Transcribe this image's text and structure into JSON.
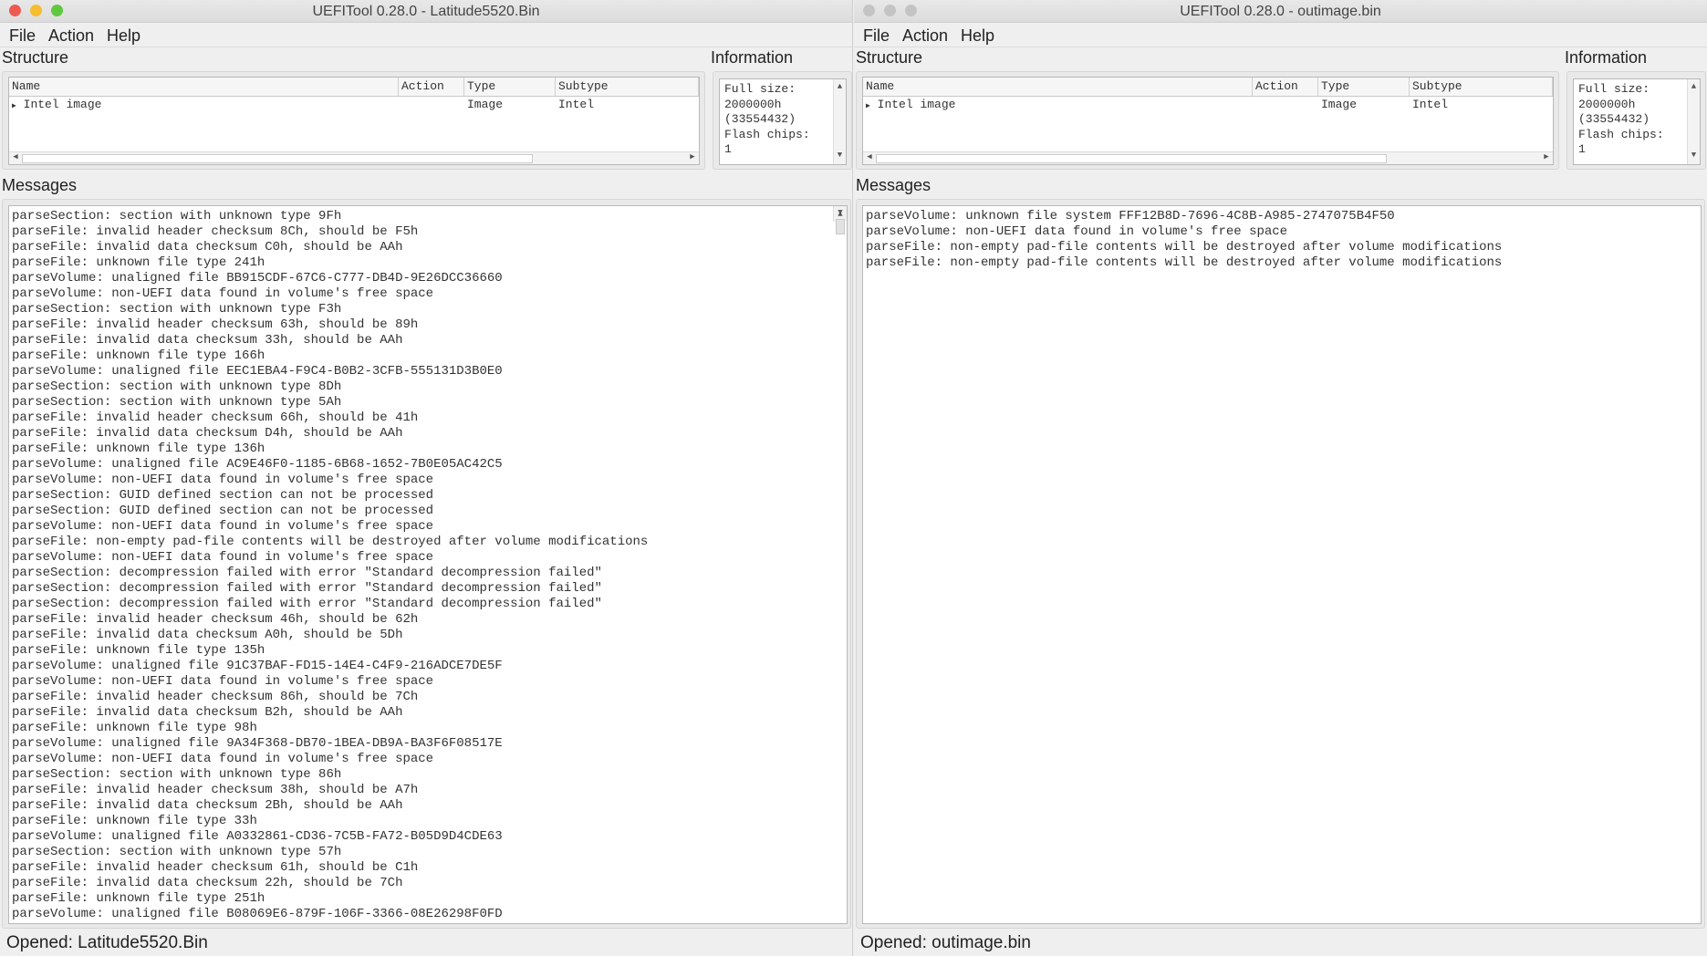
{
  "windows": [
    {
      "title": "UEFITool 0.28.0 - Latitude5520.Bin",
      "active": true,
      "menu": [
        "File",
        "Action",
        "Help"
      ],
      "structure_label": "Structure",
      "information_label": "Information",
      "messages_label": "Messages",
      "columns": [
        "Name",
        "Action",
        "Type",
        "Subtype"
      ],
      "rows": [
        {
          "name": "Intel image",
          "action": "",
          "type": "Image",
          "subtype": "Intel"
        }
      ],
      "info_lines": [
        "Full size:",
        "2000000h",
        "(33554432)",
        "Flash chips:",
        "1"
      ],
      "messages": [
        "parseSection: section with unknown type 9Fh",
        "parseFile: invalid header checksum 8Ch, should be F5h",
        "parseFile: invalid data checksum C0h, should be AAh",
        "parseFile: unknown file type 241h",
        "parseVolume: unaligned file BB915CDF-67C6-C777-DB4D-9E26DCC36660",
        "parseVolume: non-UEFI data found in volume's free space",
        "parseSection: section with unknown type F3h",
        "parseFile: invalid header checksum 63h, should be 89h",
        "parseFile: invalid data checksum 33h, should be AAh",
        "parseFile: unknown file type 166h",
        "parseVolume: unaligned file EEC1EBA4-F9C4-B0B2-3CFB-555131D3B0E0",
        "parseSection: section with unknown type 8Dh",
        "parseSection: section with unknown type 5Ah",
        "parseFile: invalid header checksum 66h, should be 41h",
        "parseFile: invalid data checksum D4h, should be AAh",
        "parseFile: unknown file type 136h",
        "parseVolume: unaligned file AC9E46F0-1185-6B68-1652-7B0E05AC42C5",
        "parseVolume: non-UEFI data found in volume's free space",
        "parseSection: GUID defined section can not be processed",
        "parseSection: GUID defined section can not be processed",
        "parseVolume: non-UEFI data found in volume's free space",
        "parseFile: non-empty pad-file contents will be destroyed after volume modifications",
        "parseVolume: non-UEFI data found in volume's free space",
        "parseSection: decompression failed with error \"Standard decompression failed\"",
        "parseSection: decompression failed with error \"Standard decompression failed\"",
        "parseSection: decompression failed with error \"Standard decompression failed\"",
        "parseFile: invalid header checksum 46h, should be 62h",
        "parseFile: invalid data checksum A0h, should be 5Dh",
        "parseFile: unknown file type 135h",
        "parseVolume: unaligned file 91C37BAF-FD15-14E4-C4F9-216ADCE7DE5F",
        "parseVolume: non-UEFI data found in volume's free space",
        "parseFile: invalid header checksum 86h, should be 7Ch",
        "parseFile: invalid data checksum B2h, should be AAh",
        "parseFile: unknown file type 98h",
        "parseVolume: unaligned file 9A34F368-DB70-1BEA-DB9A-BA3F6F08517E",
        "parseVolume: non-UEFI data found in volume's free space",
        "parseSection: section with unknown type 86h",
        "parseFile: invalid header checksum 38h, should be A7h",
        "parseFile: invalid data checksum 2Bh, should be AAh",
        "parseFile: unknown file type 33h",
        "parseVolume: unaligned file A0332861-CD36-7C5B-FA72-B05D9D4CDE63",
        "parseSection: section with unknown type 57h",
        "parseFile: invalid header checksum 61h, should be C1h",
        "parseFile: invalid data checksum 22h, should be 7Ch",
        "parseFile: unknown file type 251h",
        "parseVolume: unaligned file B08069E6-879F-106F-3366-08E26298F0FD"
      ],
      "status": "Opened: Latitude5520.Bin"
    },
    {
      "title": "UEFITool 0.28.0 - outimage.bin",
      "active": false,
      "menu": [
        "File",
        "Action",
        "Help"
      ],
      "structure_label": "Structure",
      "information_label": "Information",
      "messages_label": "Messages",
      "columns": [
        "Name",
        "Action",
        "Type",
        "Subtype"
      ],
      "rows": [
        {
          "name": "Intel image",
          "action": "",
          "type": "Image",
          "subtype": "Intel"
        }
      ],
      "info_lines": [
        "Full size:",
        "2000000h",
        "(33554432)",
        "Flash chips:",
        "1"
      ],
      "messages": [
        "parseVolume: unknown file system FFF12B8D-7696-4C8B-A985-2747075B4F50",
        "parseVolume: non-UEFI data found in volume's free space",
        "parseFile: non-empty pad-file contents will be destroyed after volume modifications",
        "parseFile: non-empty pad-file contents will be destroyed after volume modifications"
      ],
      "status": "Opened: outimage.bin"
    }
  ],
  "colors": {
    "close": "#ee5a52",
    "minimize": "#f5bd2f",
    "maximize": "#5fc83f",
    "inactive": "#c4c4c4"
  }
}
